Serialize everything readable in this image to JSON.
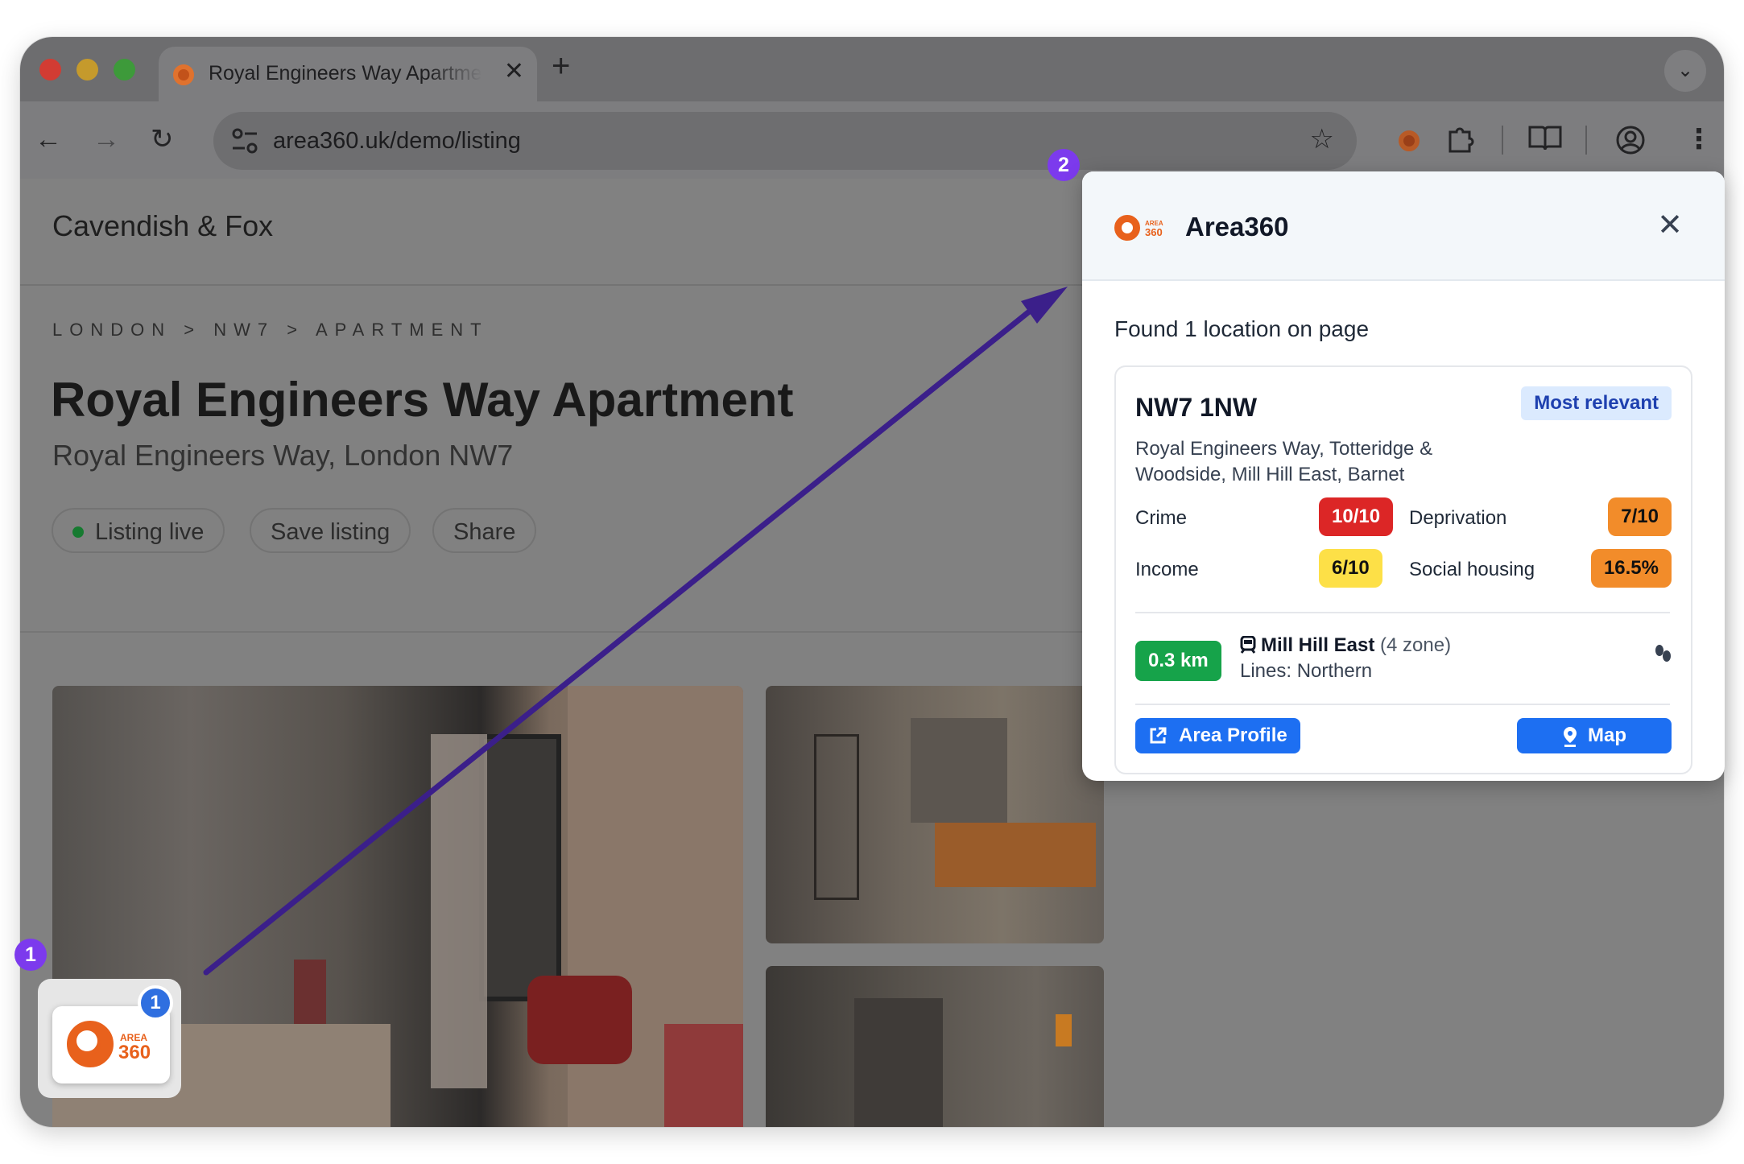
{
  "browser": {
    "tab_title": "Royal Engineers Way Apartment",
    "tab_close": "✕",
    "new_tab": "+",
    "tabs_menu": "⌄",
    "url": "area360.uk/demo/listing",
    "nav": {
      "back": "←",
      "forward": "→",
      "reload": "↻",
      "star": "☆",
      "menu": "⋮"
    },
    "icons": [
      "back-icon",
      "forward-icon",
      "reload-icon",
      "site-settings-icon",
      "bookmark-star-icon",
      "area360-extension-icon",
      "extensions-puzzle-icon",
      "reading-list-icon",
      "profile-icon",
      "more-menu-icon"
    ]
  },
  "site": {
    "brand": "Cavendish & Fox",
    "breadcrumb": "LONDON > NW7 > APARTMENT",
    "title": "Royal Engineers Way Apartment",
    "subtitle": "Royal Engineers Way, London NW7",
    "actions": {
      "live": "Listing live",
      "save": "Save listing",
      "share": "Share"
    }
  },
  "annotations": {
    "marker_1": "1",
    "marker_2": "2",
    "arrow_color": "#3b1f8a",
    "marker_color": "#7c3aed"
  },
  "fab": {
    "logo_area": "AREA",
    "logo_360": "360",
    "count": "1"
  },
  "popup": {
    "logo_area": "AREA",
    "logo_360": "360",
    "title": "Area360",
    "close": "✕",
    "found_text": "Found 1 location on page",
    "result": {
      "postcode": "NW7 1NW",
      "badge": "Most relevant",
      "address": "Royal Engineers Way, Totteridge & Woodside, Mill Hill East, Barnet",
      "stats": {
        "crime": {
          "label": "Crime",
          "value": "10/10",
          "color": "#dc2626"
        },
        "deprivation": {
          "label": "Deprivation",
          "value": "7/10",
          "color": "#f28c2a"
        },
        "income": {
          "label": "Income",
          "value": "6/10",
          "color": "#fde047"
        },
        "social_housing": {
          "label": "Social housing",
          "value": "16.5%",
          "color": "#f28c2a"
        }
      },
      "transport": {
        "distance": "0.3 km",
        "station": "Mill Hill East",
        "zone": "(4 zone)",
        "lines": "Lines: Northern"
      },
      "buttons": {
        "area_profile": "Area Profile",
        "map": "Map"
      }
    }
  }
}
